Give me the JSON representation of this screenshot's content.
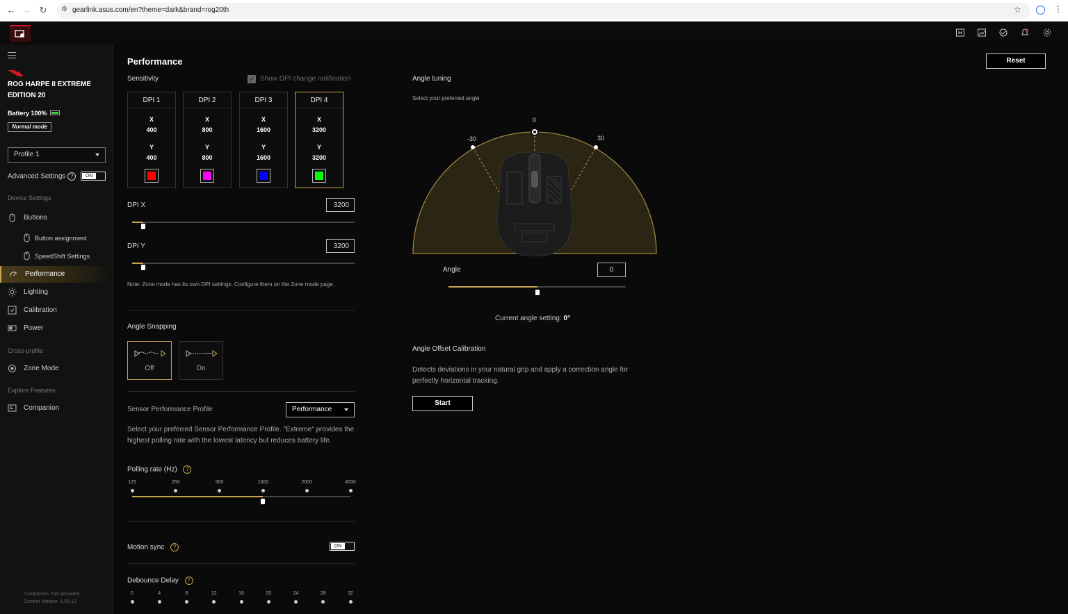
{
  "browser": {
    "url": "gearlink.asus.com/en?theme=dark&brand=rog20th"
  },
  "sidebar": {
    "device_name": "ROG HARPE II EXTREME EDITION 20",
    "battery": "Battery 100%",
    "mode": "Normal mode",
    "profile": "Profile 1",
    "advanced_settings": "Advanced Settings",
    "advanced_toggle": "ON",
    "device_settings_label": "Device Settings",
    "items": {
      "buttons": "Buttons",
      "button_assignment": "Button assignment",
      "speedshift": "SpeedShift Settings",
      "performance": "Performance",
      "lighting": "Lighting",
      "calibration": "Calibration",
      "power": "Power"
    },
    "cross_profile_label": "Cross-profile",
    "zone_mode": "Zone Mode",
    "explore_label": "Explore Features",
    "companion": "Companion",
    "footer_status": "Companion:  Not activated",
    "footer_version": "Current Version: 1.00.12"
  },
  "main": {
    "title": "Performance",
    "reset": "Reset",
    "sensitivity": "Sensitivity",
    "show_dpi_notification": "Show DPI change notification",
    "dpi_stages": [
      {
        "name": "DPI 1",
        "x_label": "X",
        "x": "400",
        "y_label": "Y",
        "y": "400",
        "color": "#ff0000"
      },
      {
        "name": "DPI 2",
        "x_label": "X",
        "x": "800",
        "y_label": "Y",
        "y": "800",
        "color": "#ff00ff"
      },
      {
        "name": "DPI 3",
        "x_label": "X",
        "x": "1600",
        "y_label": "Y",
        "y": "1600",
        "color": "#0000ff"
      },
      {
        "name": "DPI 4",
        "x_label": "X",
        "x": "3200",
        "y_label": "Y",
        "y": "3200",
        "color": "#00ff00"
      }
    ],
    "selected_stage": "DPI 4",
    "dpi_x_label": "DPI X",
    "dpi_x_value": "3200",
    "dpi_x_fraction": 0.05,
    "dpi_y_label": "DPI Y",
    "dpi_y_value": "3200",
    "dpi_y_fraction": 0.05,
    "zone_note": "Note: Zone mode has its own DPI settings. Configure them on the Zone mode page.",
    "angle_snapping": "Angle Snapping",
    "snap_off": "Off",
    "snap_on": "On",
    "sensor_profile_label": "Sensor Performance Profile",
    "sensor_profile_value": "Performance",
    "sensor_profile_desc": "Select your preferred Sensor Performance Profile. \"Extreme\" provides the highest polling rate with the lowest latency but reduces battery life.",
    "polling_label": "Polling rate (Hz)",
    "polling_ticks": [
      "125",
      "250",
      "500",
      "1000",
      "2000",
      "4000"
    ],
    "polling_selected": "1000",
    "motion_sync": "Motion sync",
    "motion_sync_toggle": "ON",
    "debounce_label": "Debounce Delay",
    "debounce_ticks": [
      "0",
      "4",
      "8",
      "12",
      "16",
      "20",
      "24",
      "28",
      "32"
    ]
  },
  "angle": {
    "title": "Angle tuning",
    "subtitle": "Select your preferred angle",
    "marks": [
      "-30",
      "0",
      "30"
    ],
    "label": "Angle",
    "value": "0",
    "current_prefix": "Current angle setting: ",
    "current_value": "0°",
    "slider_fraction": 0.5,
    "offset_title": "Angle Offset Calibration",
    "offset_desc": "Detects deviations in your natural grip and apply a correction angle for perfectly horizontal tracking.",
    "start": "Start"
  },
  "colors": {
    "accent": "#c9a450",
    "rog_red": "#d3171d"
  }
}
